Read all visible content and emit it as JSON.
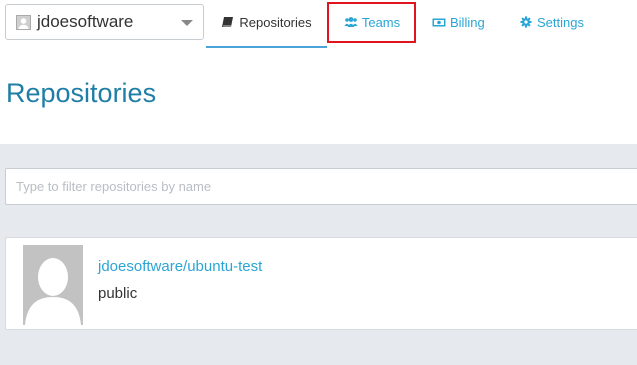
{
  "account": {
    "name": "jdoesoftware"
  },
  "nav": {
    "repositories": "Repositories",
    "teams": "Teams",
    "billing": "Billing",
    "settings": "Settings",
    "active": "Repositories",
    "highlighted": "Teams"
  },
  "icons": {
    "account_avatar": "user-avatar-icon",
    "dropdown": "chevron-down-icon",
    "repositories": "book-icon",
    "teams": "users-icon",
    "billing": "money-bill-icon",
    "settings": "gear-icon"
  },
  "page": {
    "title": "Repositories"
  },
  "filter": {
    "placeholder": "Type to filter repositories by name"
  },
  "repositories": [
    {
      "name": "jdoesoftware/ubuntu-test",
      "visibility": "public"
    }
  ],
  "colors": {
    "link": "#2aa5d6",
    "title": "#1f7ea6",
    "content_bg": "#e6eaee",
    "highlight": "#e0141e"
  }
}
